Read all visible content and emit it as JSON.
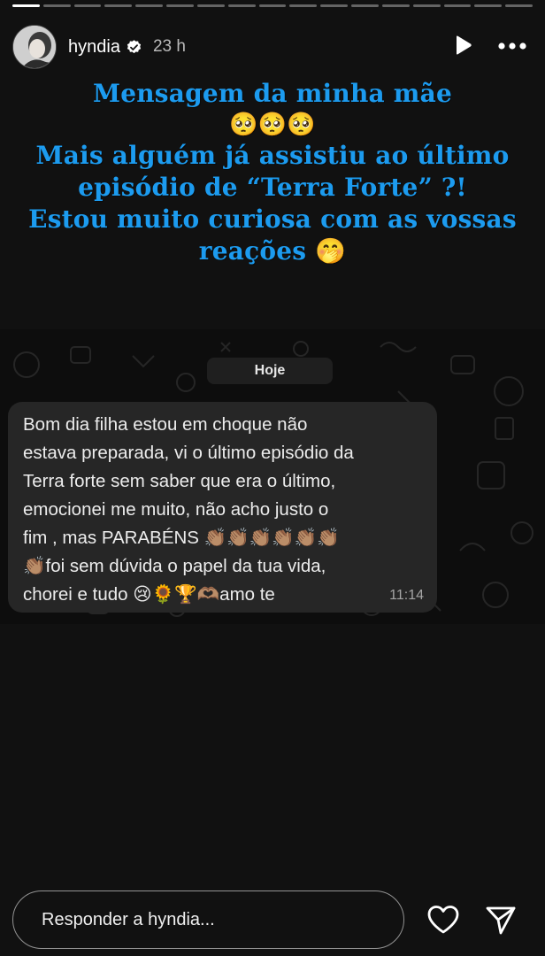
{
  "story": {
    "segments": [
      1,
      0,
      0,
      0,
      0,
      0,
      0,
      0,
      0,
      0,
      0,
      0,
      0,
      0,
      0,
      0,
      0
    ]
  },
  "header": {
    "username": "hyndia",
    "time": "23 h",
    "icons": {
      "avatar": "avatar",
      "verified": "verified-badge-icon",
      "play": "play-icon",
      "more": "more-icon"
    }
  },
  "caption": {
    "line1": "Mensagem da minha mãe",
    "line2": "🥺🥺🥺",
    "line3": "Mais alguém já assistiu ao último",
    "line4": "episódio de “Terra Forte” ?!",
    "line5": "Estou muito curiosa com as vossas",
    "line6": "reações 🤭"
  },
  "chat": {
    "date": "Hoje",
    "message_lines": [
      "Bom dia filha estou em choque não",
      "estava preparada, vi o último episódio da",
      "Terra forte sem saber que era o último,",
      "emocionei me muito, não acho justo o",
      "fim , mas PARABÉNS 👏🏽👏🏽👏🏽👏🏽👏🏽👏🏽",
      "👏🏽foi sem dúvida o papel da tua vida,",
      "chorei e tudo 😢🌻🏆🫶🏽amo te"
    ],
    "time": "11:14"
  },
  "footer": {
    "reply_placeholder": "Responder a hyndia...",
    "icons": {
      "like": "heart-icon",
      "share": "send-icon"
    }
  },
  "colors": {
    "caption": "#1c9bef",
    "background": "#111111",
    "bubble": "#262626"
  }
}
